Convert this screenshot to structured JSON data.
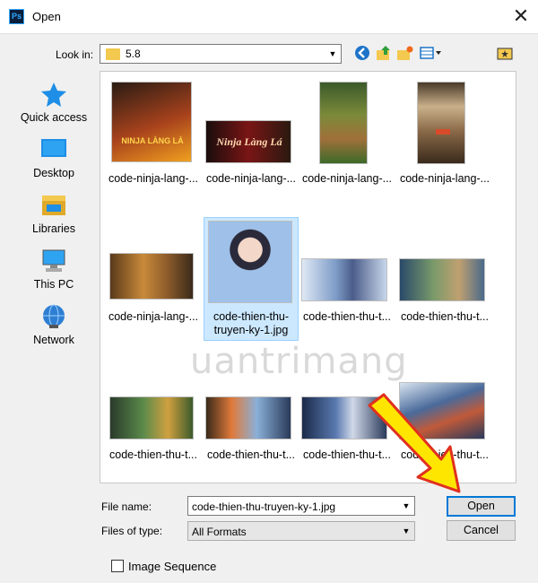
{
  "window": {
    "title": "Open",
    "app_icon_text": "Ps",
    "close_glyph": "✕"
  },
  "look_in": {
    "label": "Look in:",
    "value": "5.8"
  },
  "toolbar": {
    "icons": [
      "back-icon",
      "up-folder-icon",
      "new-folder-icon",
      "view-menu-icon",
      "folder-pin-icon"
    ]
  },
  "places": [
    {
      "label": "Quick access",
      "icon": "star-icon"
    },
    {
      "label": "Desktop",
      "icon": "desktop-icon"
    },
    {
      "label": "Libraries",
      "icon": "libraries-icon"
    },
    {
      "label": "This PC",
      "icon": "computer-icon"
    },
    {
      "label": "Network",
      "icon": "network-icon"
    }
  ],
  "files": [
    {
      "caption": "code-ninja-lang-..."
    },
    {
      "caption": "code-ninja-lang-..."
    },
    {
      "caption": "code-ninja-lang-..."
    },
    {
      "caption": "code-ninja-lang-..."
    },
    {
      "caption": "code-ninja-lang-..."
    },
    {
      "caption": "code-thien-thu-truyen-ky-1.jpg",
      "selected": true
    },
    {
      "caption": "code-thien-thu-t..."
    },
    {
      "caption": "code-thien-thu-t..."
    },
    {
      "caption": "code-thien-thu-t..."
    },
    {
      "caption": "code-thien-thu-t..."
    },
    {
      "caption": "code-thien-thu-t..."
    },
    {
      "caption": "code-thien-thu-t..."
    }
  ],
  "thumb_texts": {
    "ninja_logo": "NINJA LÀNG LÁ",
    "ninja_logo2": "Ninja Làng Lá"
  },
  "watermark": "uantrimang",
  "file_name": {
    "label": "File name:",
    "value": "code-thien-thu-truyen-ky-1.jpg"
  },
  "file_type": {
    "label": "Files of type:",
    "value": "All Formats"
  },
  "buttons": {
    "open": "Open",
    "cancel": "Cancel"
  },
  "image_sequence": {
    "label": "Image Sequence",
    "checked": false
  },
  "colors": {
    "accent": "#0078d7",
    "selection": "#cce8ff",
    "annotation_arrow": "#ffe600"
  }
}
